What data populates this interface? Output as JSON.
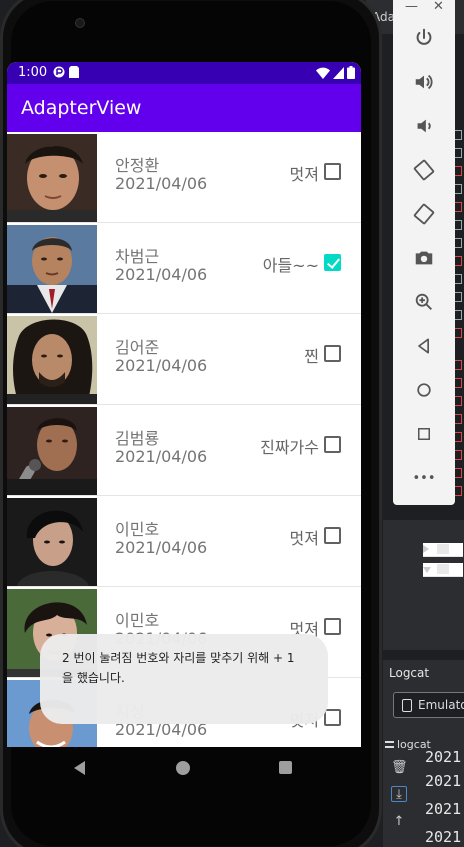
{
  "ide": {
    "window_title": "Ada",
    "logcat_title": "Logcat",
    "emulator_label": "Emulator",
    "logcat_tab": "logcat",
    "log_lines": [
      "2021",
      "2021",
      "2021",
      "2021"
    ]
  },
  "emulator_panel": {
    "minimize": "—",
    "close": "✕",
    "buttons": [
      "power-icon",
      "volume-up-icon",
      "volume-down-icon",
      "rotate-left-icon",
      "rotate-right-icon",
      "camera-icon",
      "zoom-icon",
      "back-icon",
      "home-icon",
      "overview-icon",
      "more-icon"
    ],
    "more_label": "•••"
  },
  "status_bar": {
    "time": "1:00"
  },
  "app_bar": {
    "title": "AdapterView"
  },
  "list": {
    "items": [
      {
        "name": "안정환",
        "date": "2021/04/06",
        "comment": "멋져",
        "checked": false
      },
      {
        "name": "차범근",
        "date": "2021/04/06",
        "comment": "아들~~",
        "checked": true
      },
      {
        "name": "김어준",
        "date": "2021/04/06",
        "comment": "찐",
        "checked": false
      },
      {
        "name": "김범룡",
        "date": "2021/04/06",
        "comment": "진짜가수",
        "checked": false
      },
      {
        "name": "이민호",
        "date": "2021/04/06",
        "comment": "멋져",
        "checked": false
      },
      {
        "name": "이민호",
        "date": "2021/04/06",
        "comment": "멋져",
        "checked": false
      },
      {
        "name": "지성",
        "date": "2021/04/06",
        "comment": "멋져",
        "checked": false
      }
    ]
  },
  "toast": {
    "line1": "2 번이 눌려짐 번호와 자리를 맞추기 위해 + 1",
    "line2": "을 했습니다."
  },
  "colors": {
    "status_bar": "#3700b3",
    "app_bar": "#6200ee",
    "checkbox_accent": "#03dac5"
  }
}
